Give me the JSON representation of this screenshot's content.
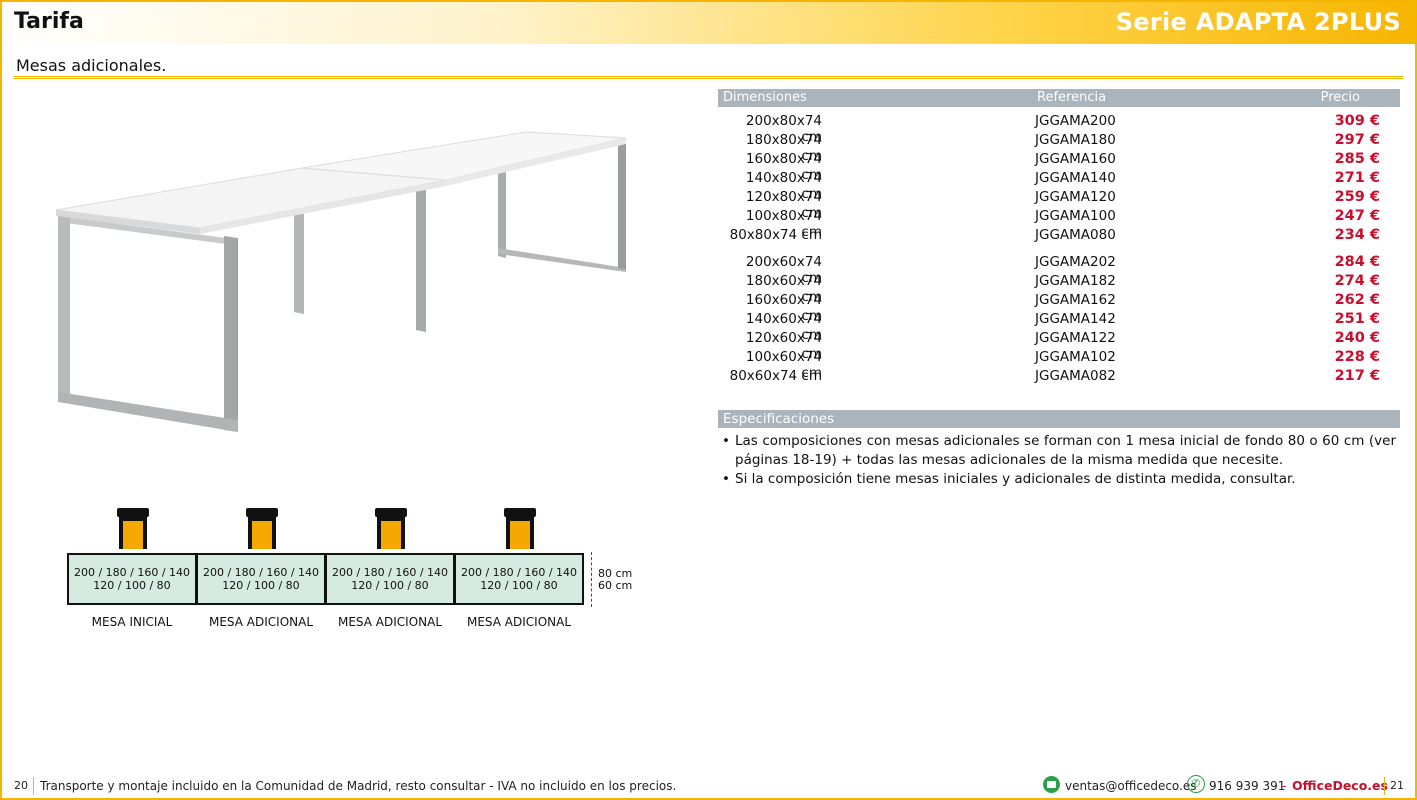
{
  "header": {
    "title": "Tarifa",
    "series": "Serie ADAPTA 2PLUS"
  },
  "subtitle": "Mesas adicionales.",
  "table": {
    "headers": {
      "dimensions": "Dimensiones",
      "reference": "Referencia",
      "price": "Precio"
    },
    "group1": [
      {
        "dim": "200x80x74 cm",
        "ref": "JGGAMA200",
        "price": "309 €"
      },
      {
        "dim": "180x80x74 cm",
        "ref": "JGGAMA180",
        "price": "297 €"
      },
      {
        "dim": "160x80x74 cm",
        "ref": "JGGAMA160",
        "price": "285 €"
      },
      {
        "dim": "140x80x74 cm",
        "ref": "JGGAMA140",
        "price": "271 €"
      },
      {
        "dim": "120x80x74 cm",
        "ref": "JGGAMA120",
        "price": "259 €"
      },
      {
        "dim": "100x80x74 cm",
        "ref": "JGGAMA100",
        "price": "247 €"
      },
      {
        "dim": "80x80x74 cm",
        "ref": "JGGAMA080",
        "price": "234 €"
      }
    ],
    "group2": [
      {
        "dim": "200x60x74 cm",
        "ref": "JGGAMA202",
        "price": "284 €"
      },
      {
        "dim": "180x60x74 cm",
        "ref": "JGGAMA182",
        "price": "274 €"
      },
      {
        "dim": "160x60x74 cm",
        "ref": "JGGAMA162",
        "price": "262 €"
      },
      {
        "dim": "140x60x74 cm",
        "ref": "JGGAMA142",
        "price": "251 €"
      },
      {
        "dim": "120x60x74 cm",
        "ref": "JGGAMA122",
        "price": "240 €"
      },
      {
        "dim": "100x60x74 cm",
        "ref": "JGGAMA102",
        "price": "228 €"
      },
      {
        "dim": "80x60x74 cm",
        "ref": "JGGAMA082",
        "price": "217 €"
      }
    ]
  },
  "specs": {
    "title": "Especificaciones",
    "items": [
      "Las composiciones con mesas adicionales se forman con 1 mesa inicial de fondo 80 o 60 cm (ver páginas 18-19) + todas las mesas adicionales de la misma medida que necesite.",
      "Si la composición tiene mesas iniciales y adicionales de distinta medida, consultar."
    ]
  },
  "diagram": {
    "desks": [
      {
        "line1": "200 / 180 / 160 / 140",
        "line2": "120 / 100 / 80",
        "label": "MESA INICIAL"
      },
      {
        "line1": "200 / 180 / 160 / 140",
        "line2": "120 / 100 / 80",
        "label": "MESA ADICIONAL"
      },
      {
        "line1": "200 / 180 / 160 / 140",
        "line2": "120 / 100 / 80",
        "label": "MESA ADICIONAL"
      },
      {
        "line1": "200 / 180 / 160 / 140",
        "line2": "120 / 100 / 80",
        "label": "MESA ADICIONAL"
      }
    ],
    "depth1": "80 cm",
    "depth2": "60 cm"
  },
  "footer": {
    "page_left": "20",
    "note": "Transporte y montaje incluido en la Comunidad de Madrid, resto consultar - IVA no incluido en los precios.",
    "email": "ventas@officedeco.es",
    "phone": "916 939 391",
    "dash": "-",
    "brand": "OfficeDeco.es",
    "page_right": "21"
  },
  "colors": {
    "accent": "#f4b400",
    "price": "#c8102e",
    "table_header": "#a9b4bc",
    "desk_fill": "#d5ebdf",
    "chair_seat": "#f4a800",
    "contact_green": "#2e9e48"
  }
}
